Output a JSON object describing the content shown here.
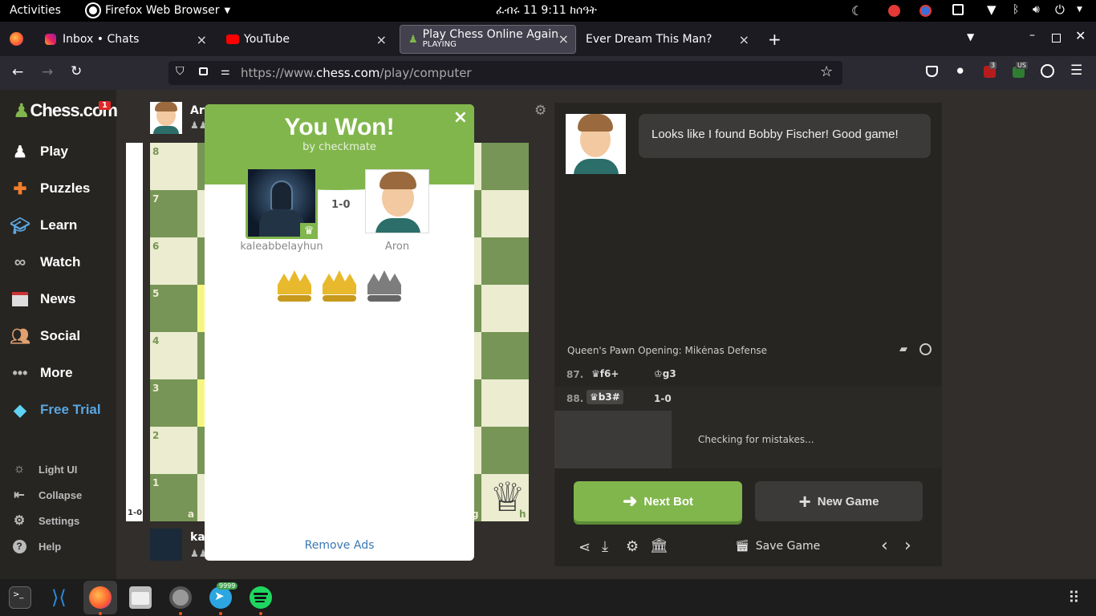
{
  "system_bar": {
    "activities": "Activities",
    "app_name": "Firefox Web Browser",
    "clock": "ፈብሩ 11   9:11 ከሰዓት"
  },
  "tabs": [
    {
      "label": "Inbox • Chats"
    },
    {
      "label": "YouTube"
    },
    {
      "label": "Play Chess Online Against",
      "sublabel": "PLAYING"
    },
    {
      "label": "Ever Dream This Man?"
    }
  ],
  "url": {
    "prefix": "https://www.",
    "domain": "chess.com",
    "path": "/play/computer"
  },
  "extensions": {
    "badge_count": "3",
    "us_label": "US"
  },
  "sidebar": {
    "logo": "Chess.com",
    "notification_count": "1",
    "items": [
      {
        "label": "Play"
      },
      {
        "label": "Puzzles"
      },
      {
        "label": "Learn"
      },
      {
        "label": "Watch"
      },
      {
        "label": "News"
      },
      {
        "label": "Social"
      },
      {
        "label": "More"
      },
      {
        "label": "Free Trial"
      }
    ],
    "footer": [
      {
        "label": "Light UI"
      },
      {
        "label": "Collapse"
      },
      {
        "label": "Settings"
      },
      {
        "label": "Help"
      }
    ]
  },
  "board": {
    "top_player": "Ar",
    "bottom_player": "ka",
    "eval": "1-0",
    "ranks": [
      "8",
      "7",
      "6",
      "5",
      "4",
      "3",
      "2",
      "1"
    ],
    "file_a": "a",
    "file_g": "g",
    "file_h": "h"
  },
  "modal": {
    "title": "You Won!",
    "subtitle": "by checkmate",
    "score": "1-0",
    "player1": "kaleabbelayhun",
    "player2": "Aron",
    "remove_ads": "Remove Ads"
  },
  "right_panel": {
    "bot_message": "Looks like I found Bobby Fischer! Good game!",
    "opening": "Queen's Pawn Opening: Mikėnas Defense",
    "moves": [
      {
        "num": "87.",
        "white": "f6+",
        "black": "g3"
      },
      {
        "num": "88.",
        "white": "b3#",
        "black": "1-0"
      }
    ],
    "analysis": "Checking for mistakes...",
    "next_bot": "Next Bot",
    "new_game": "New Game",
    "save_game": "Save Game"
  },
  "taskbar": {
    "telegram_badge": "9999"
  },
  "colors": {
    "accent_green": "#81b64c",
    "board_light": "#ebecd0",
    "board_dark": "#779556",
    "free_trial": "#5ba6e0",
    "crown_gold": "#e8b92c",
    "crown_gray": "#7d7d7d"
  }
}
